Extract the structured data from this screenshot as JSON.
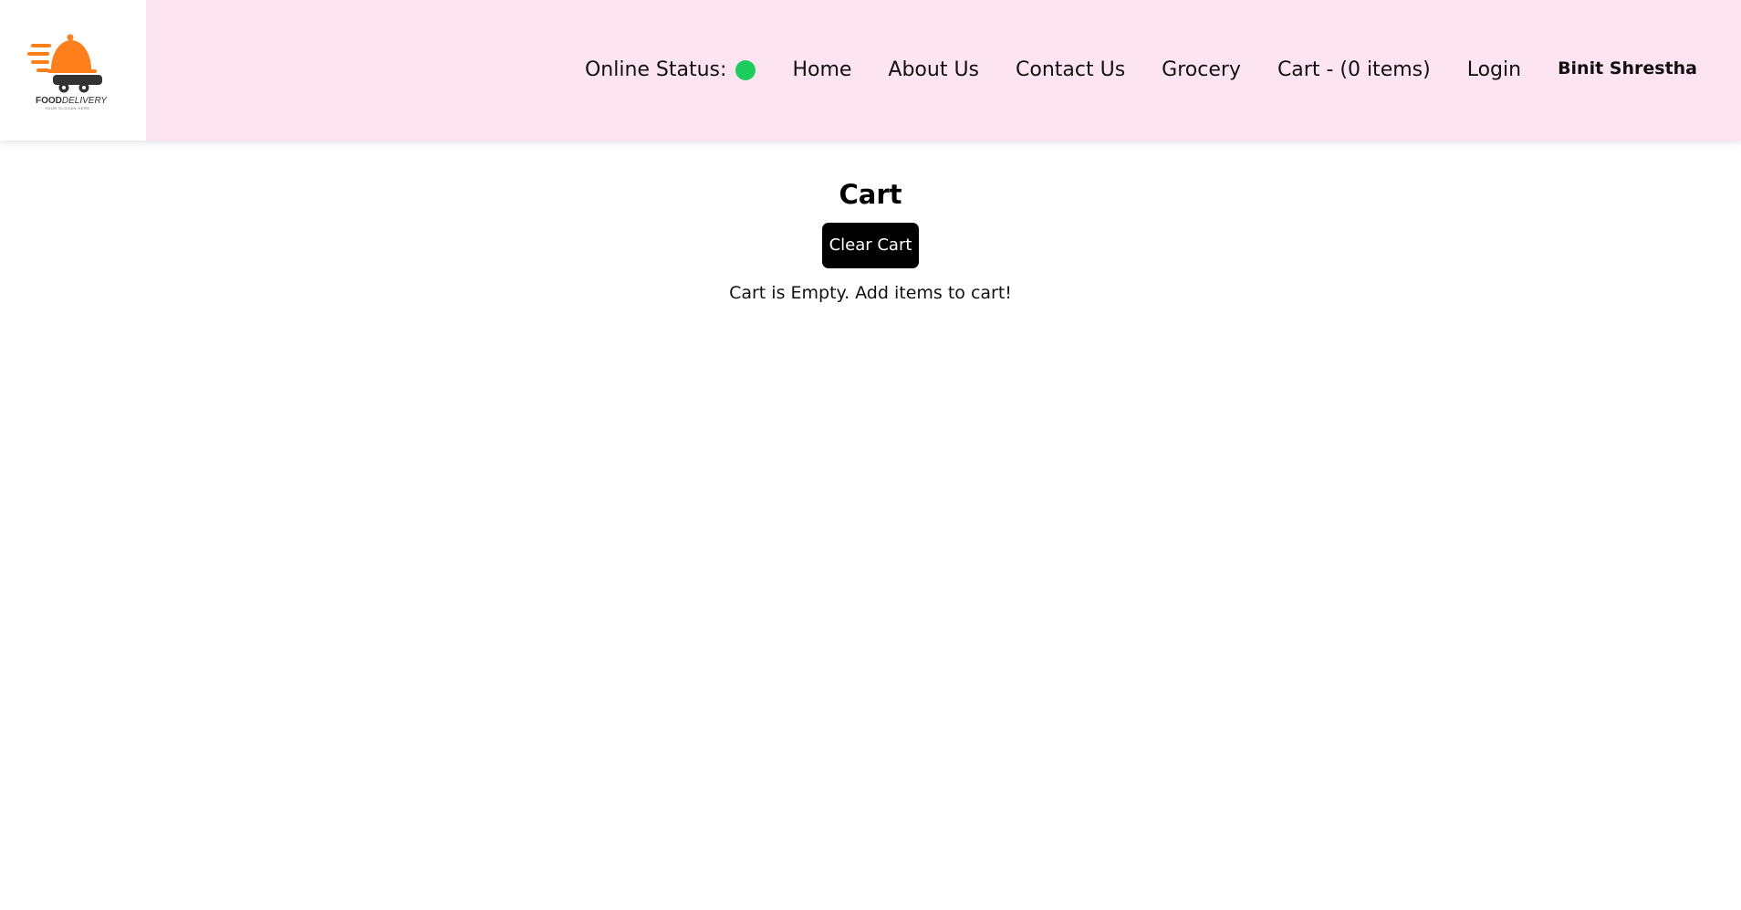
{
  "logo": {
    "brand_bold": "FOOD",
    "brand_light": "DELIVERY",
    "slogan": "YOUR SLOGAN HERE",
    "accent_color": "#ff7f1a",
    "dark_color": "#333333",
    "icon": "food-delivery-cart-icon"
  },
  "nav": {
    "online_status_label": "Online Status:",
    "online_status_color": "#1ccd5e",
    "home": "Home",
    "about": "About Us",
    "contact": "Contact Us",
    "grocery": "Grocery",
    "cart": "Cart - (0 items)",
    "login": "Login",
    "user_name": "Binit Shrestha"
  },
  "main": {
    "title": "Cart",
    "clear_button_label": "Clear Cart",
    "empty_message": "Cart is Empty. Add items to cart!"
  },
  "colors": {
    "header_bg": "#fde4f1",
    "button_bg": "#000000",
    "button_text": "#ffffff"
  }
}
